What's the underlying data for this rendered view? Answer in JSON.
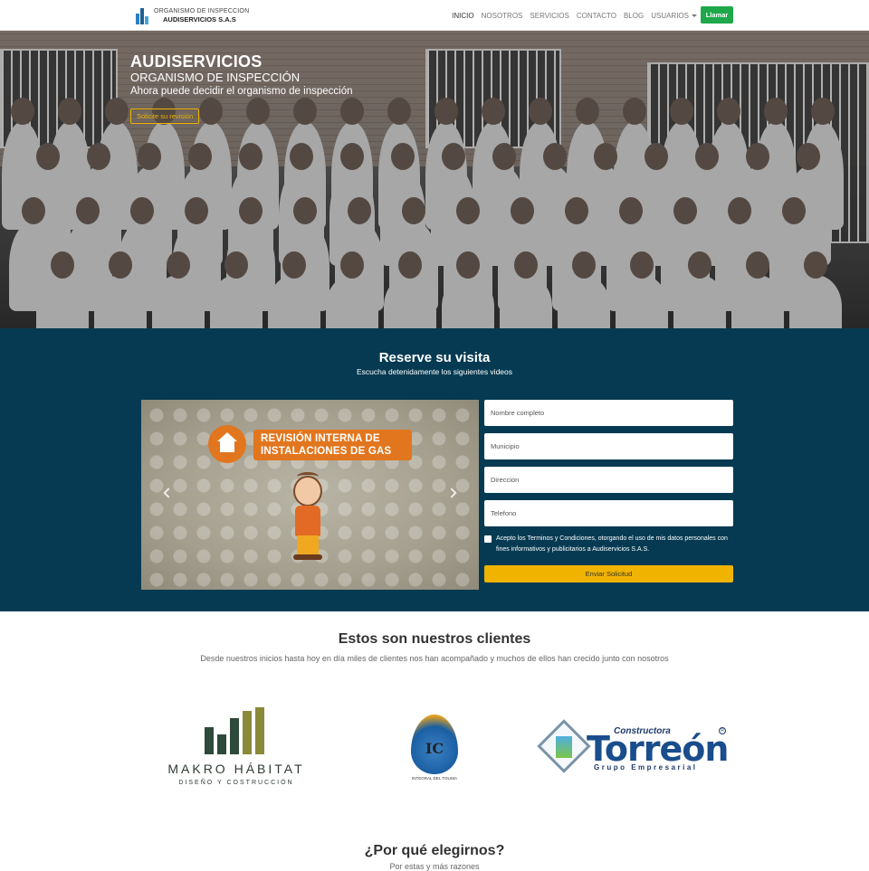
{
  "navbar": {
    "brand_top": "ORGANISMO DE INSPECCION",
    "brand_bottom": "AUDISERVICIOS S.A.S",
    "links": [
      {
        "label": "INICIO"
      },
      {
        "label": "NOSOTROS"
      },
      {
        "label": "SERVICIOS"
      },
      {
        "label": "CONTACTO"
      },
      {
        "label": "BLOG"
      },
      {
        "label": "USUARIOS"
      }
    ],
    "call_button": "Llamar",
    "accent_color": "#1ea84a"
  },
  "hero": {
    "title": "AUDISERVICIOS",
    "subtitle": "ORGANISMO DE INSPECCIÓN",
    "tagline": "Ahora puede decidir el organismo de inspección",
    "cta": "Solicite su revisión"
  },
  "reserve": {
    "title": "Reserve su visita",
    "subtitle": "Escucha detenidamente los siguientes videos",
    "video": {
      "banner_line1": "REVISIÓN INTERNA DE",
      "banner_line2": "INSTALACIONES DE GAS"
    },
    "form": {
      "fields": [
        {
          "placeholder": "Nombre completo"
        },
        {
          "placeholder": "Municipio"
        },
        {
          "placeholder": "Direccion"
        },
        {
          "placeholder": "Telefono"
        }
      ],
      "consent": "Acepto los Terminos y Condiciones, otorgando el uso de mis datos personales con fines informativos y publicitarios a Audiservicios S.A.S.",
      "submit": "Enviar Solicitud"
    },
    "background_color": "#053a52",
    "button_color": "#f0b400"
  },
  "clients": {
    "title": "Estos son nuestros clientes",
    "subtitle": "Desde nuestros inicios hasta hoy en día miles de clientes nos han acompañado y muchos de ellos han crecido junto con nosotros",
    "logos": {
      "makro_name": "MAKRO HÁBITAT",
      "makro_tag": "DISEÑO Y COSTRUCCIÓN",
      "integral_letters": "IC",
      "integral_name": "INTEGRAL DEL TOLIMA",
      "torreon_small": "Constructora",
      "torreon_big": "Torreón",
      "torreon_grupo": "Grupo Empresarial",
      "torreon_reg": "R"
    }
  },
  "why": {
    "title": "¿Por qué elegirnos?",
    "subtitle": "Por estas y más razones"
  }
}
